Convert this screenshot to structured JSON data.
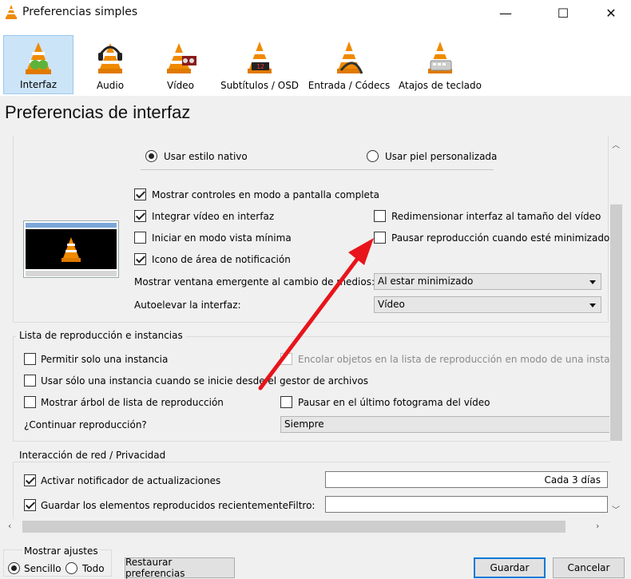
{
  "window": {
    "title": "Preferencias simples",
    "minimize_glyph": "—",
    "maximize_glyph": "☐",
    "close_glyph": "✕"
  },
  "categories": [
    {
      "label": "Interfaz",
      "icon": "interface-cone-icon"
    },
    {
      "label": "Audio",
      "icon": "audio-cone-icon"
    },
    {
      "label": "Vídeo",
      "icon": "video-cone-icon"
    },
    {
      "label": "Subtítulos / OSD",
      "icon": "subtitles-cone-icon"
    },
    {
      "label": "Entrada / Códecs",
      "icon": "input-cone-icon"
    },
    {
      "label": "Atajos de teclado",
      "icon": "hotkeys-cone-icon"
    }
  ],
  "heading": "Preferencias de interfaz",
  "look": {
    "native_label": "Usar estilo nativo",
    "skin_label": "Usar piel personalizada"
  },
  "options": {
    "fullscreen_controls": "Mostrar controles en modo a pantalla completa",
    "embed_video": "Integrar vídeo en interfaz",
    "resize_to_video": "Redimensionar interfaz al tamaño del vídeo",
    "minimal_mode": "Iniciar en modo vista mínima",
    "pause_minimized": "Pausar reproducción cuando esté minimizado",
    "systray": "Icono de área de notificación",
    "popup_label": "Mostrar ventana emergente al cambio de medios:",
    "popup_value": "Al estar minimizado",
    "raise_label": "Autoelevar la interfaz:",
    "raise_value": "Vídeo"
  },
  "playlist": {
    "title": "Lista de reproducción e instancias",
    "one_instance": "Permitir solo una instancia",
    "enqueue": "Encolar objetos en la lista de reproducción en modo de una instancia",
    "one_instance_fm": "Usar sólo una instancia cuando se inicie desde el gestor de archivos",
    "tree": "Mostrar árbol de lista de reproducción",
    "pause_last": "Pausar en el último fotograma del vídeo",
    "continue_label": "¿Continuar reproducción?",
    "continue_value": "Siempre"
  },
  "privacy": {
    "title": "Interacción de red / Privacidad",
    "updates": "Activar notificador de actualizaciones",
    "updates_value": "Cada 3 días",
    "recent": "Guardar los elementos reproducidos recientemente",
    "filter_label": "Filtro:",
    "filter_value": ""
  },
  "bottom": {
    "show_settings": "Mostrar ajustes",
    "simple": "Sencillo",
    "all": "Todo",
    "reset": "Restaurar preferencias",
    "save": "Guardar",
    "cancel": "Cancelar"
  },
  "colors": {
    "accent": "#0078d7",
    "annotation_arrow": "#e8141b",
    "selected_category": "#cce4f7"
  }
}
